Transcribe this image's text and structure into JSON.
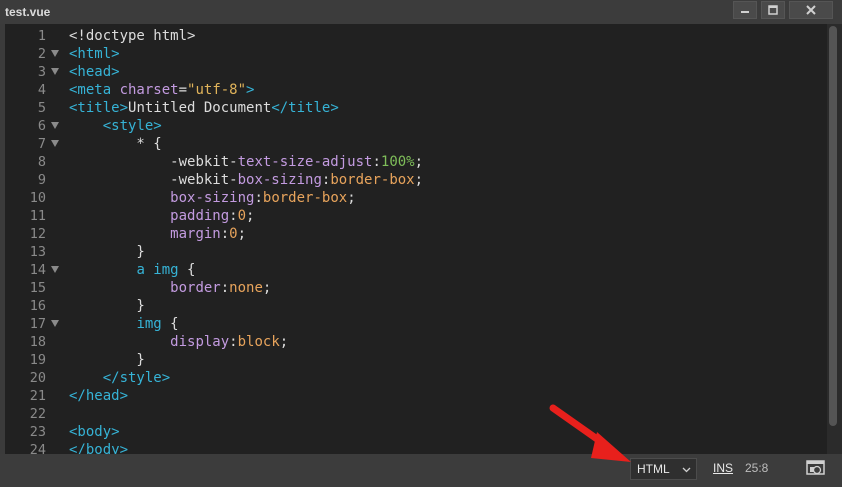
{
  "window": {
    "title": "test.vue"
  },
  "editor": {
    "lines": [
      {
        "n": "1",
        "fold": false,
        "tokens": [
          [
            "t-plain",
            "<!doctype html>"
          ]
        ]
      },
      {
        "n": "2",
        "fold": true,
        "tokens": [
          [
            "t-tag",
            "<html>"
          ]
        ]
      },
      {
        "n": "3",
        "fold": true,
        "tokens": [
          [
            "t-tag",
            "<head>"
          ]
        ]
      },
      {
        "n": "4",
        "fold": false,
        "tokens": [
          [
            "t-tag",
            "<meta "
          ],
          [
            "t-attr",
            "charset"
          ],
          [
            "t-plain",
            "="
          ],
          [
            "t-str",
            "\"utf-8\""
          ],
          [
            "t-tag",
            ">"
          ]
        ]
      },
      {
        "n": "5",
        "fold": false,
        "tokens": [
          [
            "t-tag",
            "<title>"
          ],
          [
            "t-plain",
            "Untitled Document"
          ],
          [
            "t-tag",
            "</title>"
          ]
        ]
      },
      {
        "n": "6",
        "fold": true,
        "tokens": [
          [
            "t-plain",
            "    "
          ],
          [
            "t-tag",
            "<style>"
          ]
        ]
      },
      {
        "n": "7",
        "fold": true,
        "tokens": [
          [
            "t-plain",
            "        * {"
          ]
        ]
      },
      {
        "n": "8",
        "fold": false,
        "tokens": [
          [
            "t-plain",
            "            "
          ],
          [
            "t-plain",
            "-webkit-"
          ],
          [
            "t-prop",
            "text-size-adjust"
          ],
          [
            "t-plain",
            ":"
          ],
          [
            "t-num",
            "100%"
          ],
          [
            "t-plain",
            ";"
          ]
        ]
      },
      {
        "n": "9",
        "fold": false,
        "tokens": [
          [
            "t-plain",
            "            "
          ],
          [
            "t-plain",
            "-webkit-"
          ],
          [
            "t-prop",
            "box-sizing"
          ],
          [
            "t-plain",
            ":"
          ],
          [
            "t-val",
            "border-box"
          ],
          [
            "t-plain",
            ";"
          ]
        ]
      },
      {
        "n": "10",
        "fold": false,
        "tokens": [
          [
            "t-plain",
            "            "
          ],
          [
            "t-prop",
            "box-sizing"
          ],
          [
            "t-plain",
            ":"
          ],
          [
            "t-val",
            "border-box"
          ],
          [
            "t-plain",
            ";"
          ]
        ]
      },
      {
        "n": "11",
        "fold": false,
        "tokens": [
          [
            "t-plain",
            "            "
          ],
          [
            "t-prop",
            "padding"
          ],
          [
            "t-plain",
            ":"
          ],
          [
            "t-val",
            "0"
          ],
          [
            "t-plain",
            ";"
          ]
        ]
      },
      {
        "n": "12",
        "fold": false,
        "tokens": [
          [
            "t-plain",
            "            "
          ],
          [
            "t-prop",
            "margin"
          ],
          [
            "t-plain",
            ":"
          ],
          [
            "t-val",
            "0"
          ],
          [
            "t-plain",
            ";"
          ]
        ]
      },
      {
        "n": "13",
        "fold": false,
        "tokens": [
          [
            "t-plain",
            "        }"
          ]
        ]
      },
      {
        "n": "14",
        "fold": true,
        "tokens": [
          [
            "t-plain",
            "        "
          ],
          [
            "t-tag",
            "a img"
          ],
          [
            "t-plain",
            " {"
          ]
        ]
      },
      {
        "n": "15",
        "fold": false,
        "tokens": [
          [
            "t-plain",
            "            "
          ],
          [
            "t-prop",
            "border"
          ],
          [
            "t-plain",
            ":"
          ],
          [
            "t-val",
            "none"
          ],
          [
            "t-plain",
            ";"
          ]
        ]
      },
      {
        "n": "16",
        "fold": false,
        "tokens": [
          [
            "t-plain",
            "        }"
          ]
        ]
      },
      {
        "n": "17",
        "fold": true,
        "tokens": [
          [
            "t-plain",
            "        "
          ],
          [
            "t-tag",
            "img"
          ],
          [
            "t-plain",
            " {"
          ]
        ]
      },
      {
        "n": "18",
        "fold": false,
        "tokens": [
          [
            "t-plain",
            "            "
          ],
          [
            "t-prop",
            "display"
          ],
          [
            "t-plain",
            ":"
          ],
          [
            "t-val",
            "block"
          ],
          [
            "t-plain",
            ";"
          ]
        ]
      },
      {
        "n": "19",
        "fold": false,
        "tokens": [
          [
            "t-plain",
            "        }"
          ]
        ]
      },
      {
        "n": "20",
        "fold": false,
        "tokens": [
          [
            "t-plain",
            "    "
          ],
          [
            "t-tag",
            "</style>"
          ]
        ]
      },
      {
        "n": "21",
        "fold": false,
        "tokens": [
          [
            "t-tag",
            "</head>"
          ]
        ]
      },
      {
        "n": "22",
        "fold": false,
        "tokens": []
      },
      {
        "n": "23",
        "fold": false,
        "tokens": [
          [
            "t-tag",
            "<body>"
          ]
        ]
      },
      {
        "n": "24",
        "fold": false,
        "tokens": [
          [
            "t-tag",
            "</body>"
          ]
        ]
      }
    ]
  },
  "statusbar": {
    "language": "HTML",
    "insert_mode": "INS",
    "cursor_position": "25:8"
  },
  "icons": {
    "minimize": "minimize-icon",
    "maximize": "maximize-icon",
    "close": "close-icon",
    "dropdown": "chevron-down-icon",
    "preview": "live-preview-icon",
    "annotation": "red-arrow"
  },
  "colors": {
    "annotation_arrow": "#e8201c"
  }
}
